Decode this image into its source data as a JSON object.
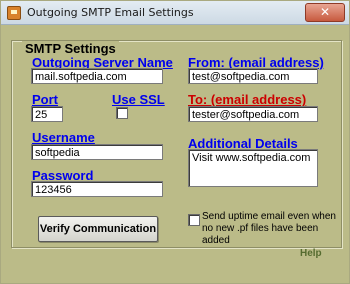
{
  "window": {
    "title": "Outgoing SMTP Email Settings",
    "close_label": "✕"
  },
  "group": {
    "title": "SMTP Settings"
  },
  "fields": {
    "server": {
      "label": "Outgoing Server Name",
      "value": "mail.softpedia.com"
    },
    "port": {
      "label": "Port",
      "value": "25"
    },
    "ssl": {
      "label": "Use SSL",
      "checked": false
    },
    "username": {
      "label": "Username",
      "value": "softpedia"
    },
    "password": {
      "label": "Password",
      "value": "123456"
    },
    "from": {
      "label": "From: (email address)",
      "value": "test@softpedia.com"
    },
    "to": {
      "label": "To: (email address)",
      "value": "tester@softpedia.com"
    },
    "details": {
      "label": "Additional Details",
      "value": "Visit www.softpedia.com"
    }
  },
  "buttons": {
    "verify": "Verify Communication"
  },
  "uptime_checkbox": {
    "label": "Send uptime email even when no new .pf files have been added",
    "checked": false
  },
  "help_label": "Help",
  "colors": {
    "window_bg": "#bbbb88",
    "link_blue": "#0000ee",
    "link_red": "#cc0000",
    "help": "#556b2f"
  }
}
